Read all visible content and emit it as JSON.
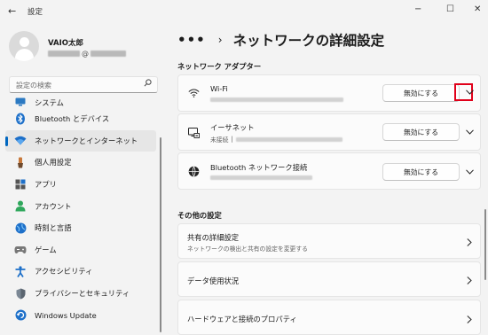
{
  "window": {
    "title": "設定",
    "controls": {
      "minimize": "−",
      "maximize": "☐",
      "close": "✕"
    }
  },
  "user": {
    "name": "VAIO太郎",
    "email_at": "@"
  },
  "search": {
    "placeholder": "設定の検索"
  },
  "sidebar": {
    "items": [
      {
        "label": "システム",
        "icon": "system-icon",
        "selected": false
      },
      {
        "label": "Bluetooth とデバイス",
        "icon": "bluetooth-icon",
        "selected": false
      },
      {
        "label": "ネットワークとインターネット",
        "icon": "wifi-icon",
        "selected": true
      },
      {
        "label": "個人用設定",
        "icon": "brush-icon",
        "selected": false
      },
      {
        "label": "アプリ",
        "icon": "apps-icon",
        "selected": false
      },
      {
        "label": "アカウント",
        "icon": "account-icon",
        "selected": false
      },
      {
        "label": "時刻と言語",
        "icon": "globe-clock-icon",
        "selected": false
      },
      {
        "label": "ゲーム",
        "icon": "gamepad-icon",
        "selected": false
      },
      {
        "label": "アクセシビリティ",
        "icon": "accessibility-icon",
        "selected": false
      },
      {
        "label": "プライバシーとセキュリティ",
        "icon": "shield-icon",
        "selected": false
      },
      {
        "label": "Windows Update",
        "icon": "update-icon",
        "selected": false
      }
    ]
  },
  "breadcrumb": {
    "dots": "•••",
    "separator": "›",
    "title": "ネットワークの詳細設定"
  },
  "adapters": {
    "section_title": "ネットワーク アダプター",
    "items": [
      {
        "name": "Wi-Fi",
        "status": "",
        "button": "無効にする",
        "icon": "wifi-icon"
      },
      {
        "name": "イーサネット",
        "status": "未接続",
        "button": "無効にする",
        "icon": "ethernet-icon"
      },
      {
        "name": "Bluetooth ネットワーク接続",
        "status": "",
        "button": "無効にする",
        "icon": "bluetooth-network-icon"
      }
    ]
  },
  "other": {
    "section_title": "その他の設定",
    "items": [
      {
        "title": "共有の詳細設定",
        "subtitle": "ネットワークの検出と共有の設定を変更する"
      },
      {
        "title": "データ使用状況",
        "subtitle": ""
      },
      {
        "title": "ハードウェアと接続のプロパティ",
        "subtitle": ""
      }
    ]
  },
  "colors": {
    "accent": "#0067c0",
    "highlight": "#e0001a",
    "background": "#f3f3f3",
    "card": "#fbfbfb"
  }
}
